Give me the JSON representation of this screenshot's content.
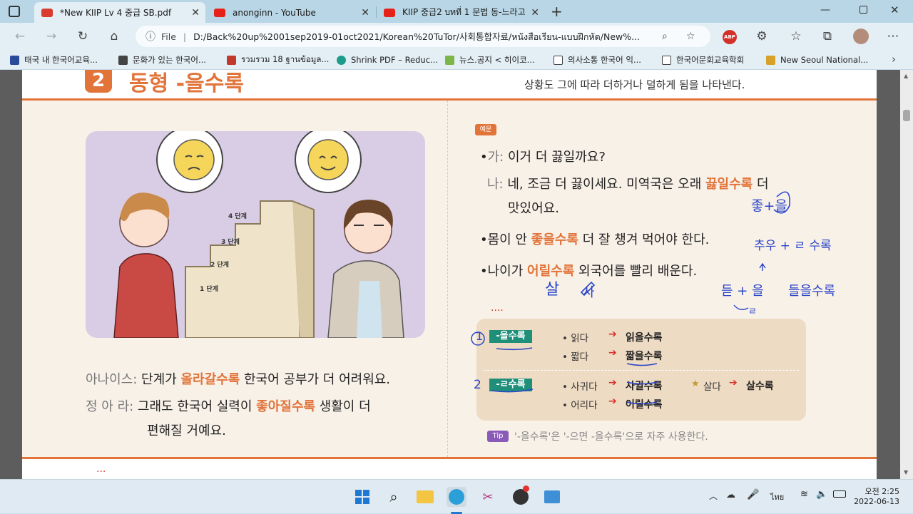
{
  "tabs": [
    {
      "title": "*New KIIP Lv 4 중급 SB.pdf",
      "icon": "pdf-icon",
      "active": true
    },
    {
      "title": "anonginn - YouTube",
      "icon": "youtube-icon",
      "active": false
    },
    {
      "title": "KIIP 중급2 บทที่ 1 문법 동-느라고",
      "icon": "youtube-icon",
      "active": false
    }
  ],
  "new_tab_label": "+",
  "address": {
    "prefix": "File",
    "url": "D:/Back%20up%2001sep2019-01oct2021/Korean%20TuTor/사회통합자료/หนังสือเรียน-แบบฝึกหัด/New%..."
  },
  "bookmarks": [
    {
      "label": "태국 내 한국어교육..."
    },
    {
      "label": "문화가 있는 한국어..."
    },
    {
      "label": "รวมรวม 18 ฐานข้อมูล..."
    },
    {
      "label": "Shrink PDF – Reduc..."
    },
    {
      "label": "뉴스.공지 < 히이코..."
    },
    {
      "label": "의사소통 한국어 익..."
    },
    {
      "label": "한국어문회교육학회"
    },
    {
      "label": "New Seoul National..."
    }
  ],
  "document": {
    "section_number": "2",
    "section_title": "동형 -을수록",
    "description": "상황도 그에 따라 더하거나 덜하게 됨을 나타낸다.",
    "illustration": {
      "steps": [
        "4 단계",
        "3 단계",
        "2 단계",
        "1 단계"
      ]
    },
    "dialogue": [
      {
        "speaker": "아나이스:",
        "pre": "단계가 ",
        "hl": "올라갈수록",
        "post": " 한국어 공부가 더 어려워요."
      },
      {
        "speaker": "정 아 라:",
        "pre": "그래도 한국어 실력이 ",
        "hl": "좋아질수록",
        "post": " 생활이 더",
        "line2": "편해질 거예요."
      }
    ],
    "example_badge": "예문",
    "examples": [
      {
        "bullet": "•",
        "prefix": "가:",
        "pre": "이거 더 끓일까요?",
        "hl": "",
        "post": ""
      },
      {
        "bullet": "",
        "prefix": "나:",
        "pre": "네, 조금 더 끓이세요. 미역국은 오래 ",
        "hl": "끓일수록",
        "post": " 더",
        "line2": "맛있어요."
      },
      {
        "bullet": "•",
        "prefix": "",
        "pre": "몸이 안 ",
        "hl": "좋을수록",
        "post": " 더 잘 챙겨 먹어야 한다."
      },
      {
        "bullet": "•",
        "prefix": "",
        "pre": "나이가 ",
        "hl": "어릴수록",
        "post": " 외국어를 빨리 배운다."
      }
    ],
    "grammar_box": {
      "rows": [
        {
          "tag": "-을수록",
          "items": [
            {
              "verb": "• 읽다",
              "result": "읽을수록"
            },
            {
              "verb": "• 짧다",
              "result": "짧을수록"
            }
          ]
        },
        {
          "tag": "-ㄹ수록",
          "items": [
            {
              "verb": "• 사귀다",
              "result": "사귈수록"
            },
            {
              "verb": "• 어리다",
              "result": "어릴수록"
            }
          ],
          "extra": {
            "star": "★",
            "verb": "살다",
            "result": "살수록"
          }
        }
      ]
    },
    "tip_badge": "Tip",
    "tip_text": "'-을수록'은 '-으면 -을수록'으로 자주 사용한다.",
    "annotations": {
      "num1": "1",
      "num2": "2",
      "joeul": "좋+을",
      "chuu": "추우 + ㄹ 수록",
      "deut": "듣 + 을",
      "deut_r": "ㄹ",
      "deureul": "들을수록",
      "sal": "살",
      "sa": "사",
      "dots1": "....",
      "dots2": "..."
    }
  },
  "taskbar": {
    "time": "오전 2:25",
    "date": "2022-06-13",
    "lang": "ไทย"
  },
  "colors": {
    "accent_orange": "#e2743a",
    "tag_green": "#1f8f7a",
    "box_bg": "#eedbc3",
    "ink_blue": "#2a45c8"
  }
}
